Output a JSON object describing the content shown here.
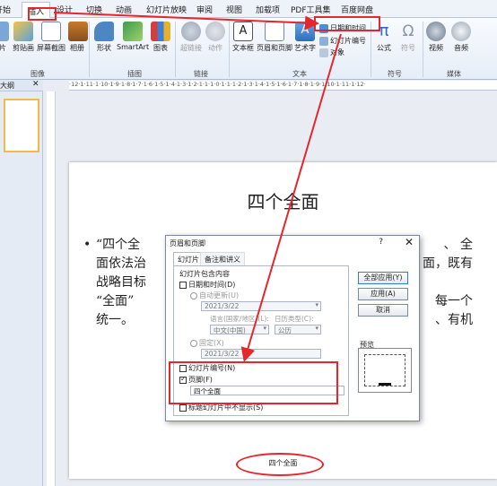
{
  "ribbon_tabs": [
    "开始",
    "插入",
    "设计",
    "切换",
    "动画",
    "幻灯片放映",
    "审阅",
    "视图",
    "加载项",
    "PDF工具集",
    "百度网盘"
  ],
  "ribbon": {
    "btn_picture_partial": "片",
    "btn_clipart": "剪贴画",
    "btn_screenshot": "屏幕截图",
    "btn_album": "相册",
    "group_image": "图像",
    "btn_shapes": "形状",
    "btn_smartart": "SmartArt",
    "btn_chart": "图表",
    "group_illustration": "插图",
    "btn_hyperlink": "超链接",
    "btn_action": "动作",
    "group_link": "链接",
    "btn_textbox": "文本框",
    "btn_header_footer": "页眉和页脚",
    "btn_wordart": "艺术字",
    "btn_datetime": "日期和时间",
    "btn_slide_number": "幻灯片编号",
    "btn_object": "对象",
    "group_text": "文本",
    "btn_equation": "公式",
    "btn_symbol": "符号",
    "group_symbol": "符号",
    "btn_video": "视频",
    "btn_audio": "音频",
    "group_media": "媒体"
  },
  "pane": {
    "outline_tab": "大纲",
    "close_glyph": "✕"
  },
  "ruler_text": "·12·1·11·1·10·1·9·1·8·1·7·1·6·1·5·1·4·1·3·1·2·1·1·1·0·1·1·1·2·1·3·1·4·1·5·1·6·1·7·1·8·1·9·1·10·1·11·1·12·",
  "slide": {
    "title": "四个全面",
    "body_lines": [
      "“四个全",
      "面依法治",
      "战略目标",
      "“全面”",
      "统一。"
    ],
    "body_right_lines": [
      "、 全",
      "面，既有",
      "每一个",
      "、有机"
    ],
    "footer": "四个全面"
  },
  "dialog": {
    "title": "页眉和页脚",
    "help": "?",
    "close": "✕",
    "tab_slide": "幻灯片",
    "tab_notes": "备注和讲义",
    "section_label": "幻灯片包含内容",
    "datetime_label": "日期和时间(D)",
    "auto_update_label": "自动更新(U)",
    "auto_date_value": "2021/3/22",
    "language_label": "语言(国家/地区)(L):",
    "calendar_label": "日历类型(C):",
    "language_value": "中文(中国)",
    "calendar_value": "公历",
    "fixed_label": "固定(X)",
    "fixed_value": "2021/3/22",
    "slide_number_label": "幻灯片编号(N)",
    "footer_label": "页脚(F)",
    "footer_value": "四个全面",
    "hide_on_title_label": "标题幻灯片中不显示(S)",
    "apply_all": "全部应用(Y)",
    "apply": "应用(A)",
    "cancel": "取消",
    "preview_label": "预览"
  },
  "colors": {
    "annotation_red": "#e5262c",
    "ribbon_bg": "#eef3fa",
    "accent_blue": "#3b78c9"
  }
}
